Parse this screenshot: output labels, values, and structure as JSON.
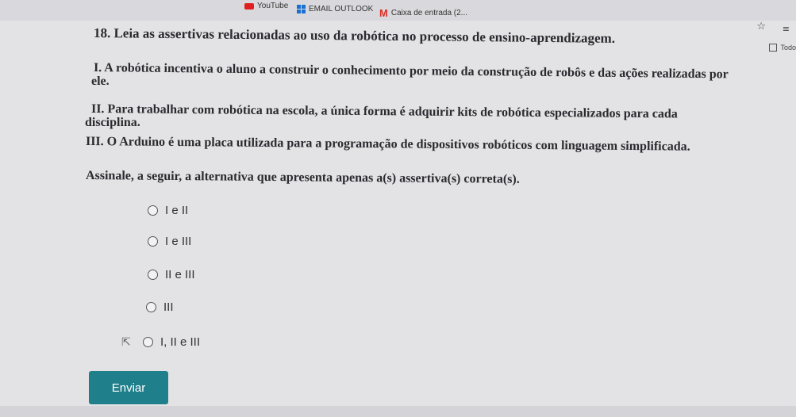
{
  "bookmarks": {
    "youtube": "YouTube",
    "outlook": "EMAIL OUTLOOK",
    "gmail": "Caixa de entrada (2..."
  },
  "todo": "Todo",
  "question": {
    "title": "18. Leia as assertivas relacionadas ao uso da robótica no processo de ensino-aprendizagem.",
    "s1_line1": "I. A robótica incentiva o aluno a construir o conhecimento por meio da construção de robôs e das ações realizadas por",
    "s1_line2": "ele.",
    "s2_line1": "II. Para trabalhar com robótica na escola, a única forma é adquirir kits de robótica especializados para cada",
    "s2_line2": "disciplina.",
    "s3": "III. O Arduino é uma placa utilizada para a programação de dispositivos robóticos com linguagem simplificada.",
    "instruction": "Assinale, a seguir, a alternativa que apresenta apenas a(s) assertiva(s) correta(s)."
  },
  "options": [
    "I e II",
    "I e III",
    "II e III",
    "III",
    "I, II e III"
  ],
  "submit_label": "Enviar"
}
